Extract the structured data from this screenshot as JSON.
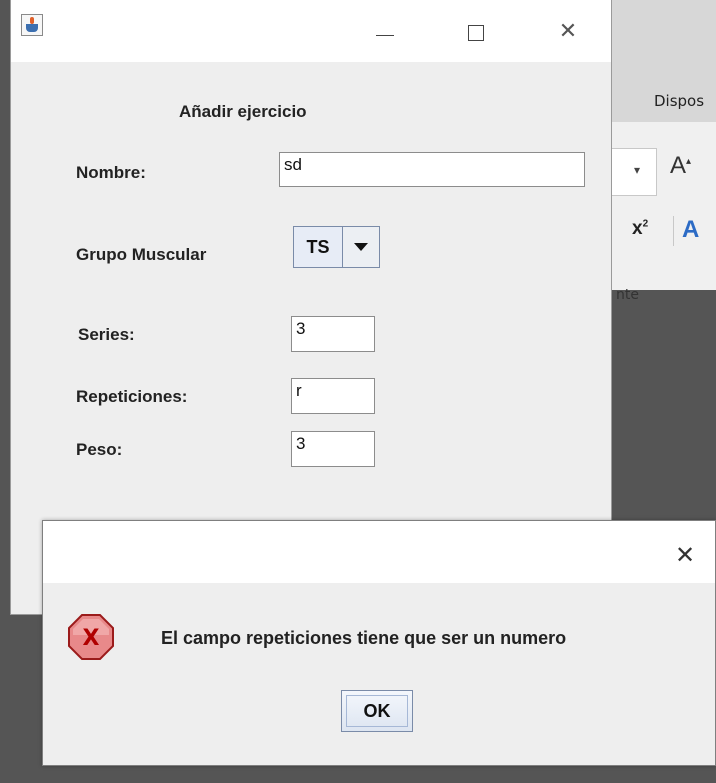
{
  "background_app": {
    "tab_label": "Dispos",
    "group_label": "nte",
    "font_size_dropdown_icon": "chevron-down-icon",
    "grow_font_label": "A",
    "superscript_label": "x",
    "superscript_sup": "2",
    "text_effects_label": "A"
  },
  "main_window": {
    "title": "",
    "app_icon": "java-cup-icon",
    "minimize_icon": "minimize-icon",
    "maximize_icon": "maximize-icon",
    "close_label": "✕",
    "form_title": "Añadir ejercicio",
    "fields": {
      "nombre_label": "Nombre:",
      "nombre_value": "sd",
      "grupo_label": "Grupo Muscular",
      "grupo_value": "TS",
      "series_label": "Series:",
      "series_value": "3",
      "repeticiones_label": "Repeticiones:",
      "repeticiones_value": "r",
      "peso_label": "Peso:",
      "peso_value": "3"
    }
  },
  "dialog": {
    "close_label": "✕",
    "error_icon": "error-icon",
    "error_icon_letter": "X",
    "message": "El campo repeticiones tiene que ser un numero",
    "ok_label": "OK"
  },
  "colors": {
    "error_icon_fill": "#e88a8a",
    "error_icon_letter": "#cc0000",
    "combo_border": "#7a8ba8"
  }
}
